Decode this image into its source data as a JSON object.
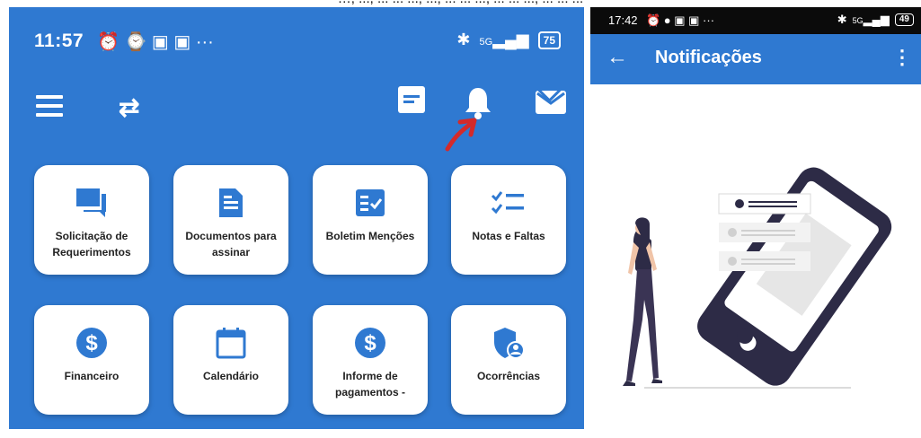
{
  "caption": "…, ..., ... ... ...; ...; ... ... ..., ... ... ..., ... ... ...",
  "left_screen": {
    "status_bar": {
      "time": "11:57",
      "icons_text": "⏰ ⌚ ▣ ▣ ···",
      "network": "5G",
      "battery": "75"
    },
    "tiles": [
      {
        "label": "Solicitação de Requerimentos",
        "icon": "chat-icon"
      },
      {
        "label": "Documentos para assinar",
        "icon": "document-icon"
      },
      {
        "label": "Boletim Menções",
        "icon": "report-check-icon"
      },
      {
        "label": "Notas e Faltas",
        "icon": "checklist-icon"
      },
      {
        "label": "Financeiro",
        "icon": "dollar-icon"
      },
      {
        "label": "Calendário",
        "icon": "calendar-icon"
      },
      {
        "label": "Informe de pagamentos -",
        "icon": "dollar-icon"
      },
      {
        "label": "Ocorrências",
        "icon": "shield-user-icon"
      }
    ],
    "colors": {
      "primary": "#2f79d1",
      "annotation_arrow": "#d42a2a"
    }
  },
  "right_screen": {
    "status_bar": {
      "time": "17:42",
      "icons_text": "⏰ ● ▣ ▣ ···",
      "network": "5G",
      "battery": "49"
    },
    "app_bar": {
      "title": "Notificações",
      "back_icon": "arrow-left-icon",
      "more_icon": "more-vert-icon"
    },
    "illustration": "empty-notifications-illustration"
  }
}
